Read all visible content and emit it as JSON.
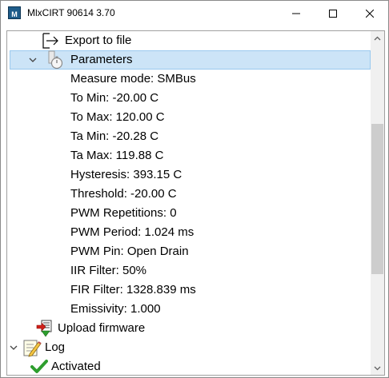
{
  "window": {
    "title": "MlxCIRT 90614 3.70",
    "app_icon_label": "M",
    "icons": {
      "minimize": "minimize-icon",
      "maximize": "maximize-icon",
      "close": "close-icon"
    }
  },
  "tree": {
    "export_to_file": {
      "label": "Export to file",
      "icon": "export-arrow-icon"
    },
    "parameters": {
      "label": "Parameters",
      "icon": "stopwatch-icon",
      "expanded": true,
      "selected": true,
      "items": [
        "Measure mode: SMBus",
        "To Min: -20.00 C",
        "To Max: 120.00 C",
        "Ta Min: -20.28 C",
        "Ta Max: 119.88 C",
        "Hysteresis: 393.15 C",
        "Threshold: -20.00 C",
        "PWM Repetitions: 0",
        "PWM Period: 1.024 ms",
        "PWM Pin: Open Drain",
        "IIR Filter: 50%",
        "FIR Filter: 1328.839 ms",
        "Emissivity: 1.000"
      ]
    },
    "upload_firmware": {
      "label": "Upload firmware",
      "icon": "upload-firmware-icon"
    },
    "log": {
      "label": "Log",
      "icon": "log-pencil-icon",
      "expanded": true,
      "children": [
        {
          "label": "Activated",
          "icon": "check-icon"
        }
      ]
    }
  },
  "colors": {
    "selection_bg": "#cce4f7",
    "selection_border": "#99c9ef",
    "scrollbar_thumb": "#cdcdcd",
    "check_green": "#2e9e2e"
  }
}
